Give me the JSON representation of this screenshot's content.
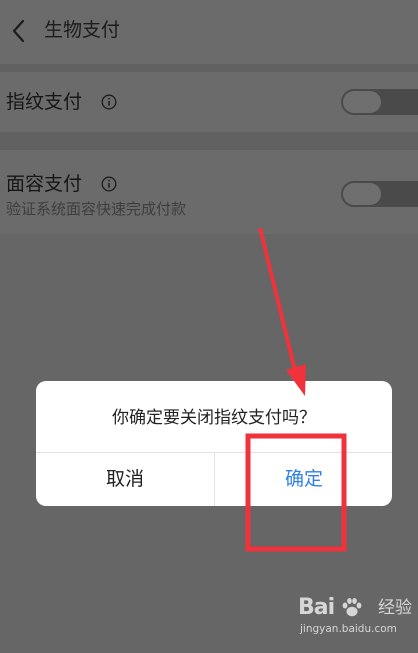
{
  "header": {
    "title": "生物支付",
    "back_icon": "chevron-left-icon"
  },
  "settings": [
    {
      "title": "指纹支付",
      "subtitle": "",
      "info_icon": "info-circle-icon",
      "toggle_state": "off"
    },
    {
      "title": "面容支付",
      "subtitle": "验证系统面容快速完成付款",
      "info_icon": "info-circle-icon",
      "toggle_state": "off"
    }
  ],
  "dialog": {
    "message": "你确定要关闭指纹支付吗？",
    "cancel_label": "取消",
    "confirm_label": "确定"
  },
  "annotation": {
    "color": "#f0323c",
    "arrow_icon": "arrow-icon",
    "highlight": "confirm-button"
  },
  "watermark": {
    "brand": "Bai",
    "product": "经验",
    "url": "jingyan.baidu.com"
  },
  "colors": {
    "accent": "#2f7fe6",
    "overlay": "#666666",
    "dialog_bg": "#ffffff"
  }
}
